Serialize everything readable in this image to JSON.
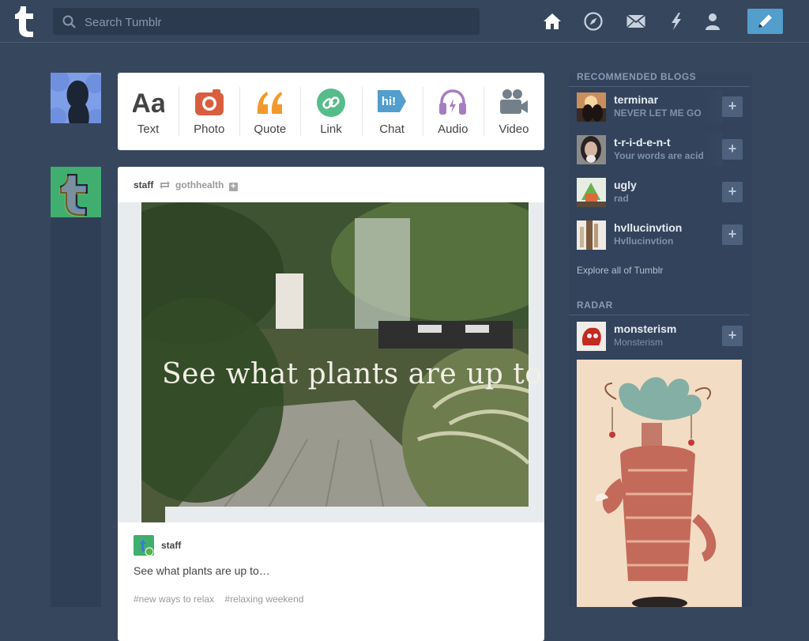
{
  "header": {
    "logo_glyph": "t",
    "search_placeholder": "Search Tumblr",
    "nav_icons": [
      "home-icon",
      "explore-compass-icon",
      "mail-icon",
      "activity-lightning-icon",
      "account-person-icon"
    ],
    "compose_icon": "pencil-icon",
    "colors": {
      "background": "#36465d",
      "search_bg": "#2b3a4f",
      "compose": "#529ecc"
    }
  },
  "post_types": [
    {
      "label": "Text",
      "icon": "text-aa-icon",
      "color": "#444444"
    },
    {
      "label": "Photo",
      "icon": "camera-icon",
      "color": "#d95e40"
    },
    {
      "label": "Quote",
      "icon": "quote-icon",
      "color": "#f2992e"
    },
    {
      "label": "Link",
      "icon": "link-icon",
      "color": "#56bc8a"
    },
    {
      "label": "Chat",
      "icon": "chat-hi-icon",
      "icon_text": "hi!",
      "color": "#529ecc"
    },
    {
      "label": "Audio",
      "icon": "headphones-icon",
      "color": "#a77dc2"
    },
    {
      "label": "Video",
      "icon": "video-camera-icon",
      "color": "#748089"
    }
  ],
  "post": {
    "poster": "staff",
    "reblogged_from": "gothhealth",
    "follow_glyph": "+",
    "image_caption": "See what plants are up to...",
    "author": "staff",
    "body": "See what plants are up to…",
    "tags": [
      "#new ways to relax",
      "#relaxing weekend"
    ]
  },
  "sidebar": {
    "recommended_title": "RECOMMENDED BLOGS",
    "blogs": [
      {
        "name": "terminar",
        "desc": "NEVER LET ME GO",
        "follow": "+"
      },
      {
        "name": "t-r-i-d-e-n-t",
        "desc": "Your words are acid",
        "follow": "+"
      },
      {
        "name": "ugly",
        "desc": "rad",
        "follow": "+"
      },
      {
        "name": "hvllucinvtion",
        "desc": "Hvllucinvtion",
        "follow": "+"
      }
    ],
    "explore_link": "Explore all of Tumblr",
    "radar_title": "RADAR",
    "radar_blog": {
      "name": "monsterism",
      "desc": "Monsterism",
      "follow": "+"
    }
  }
}
